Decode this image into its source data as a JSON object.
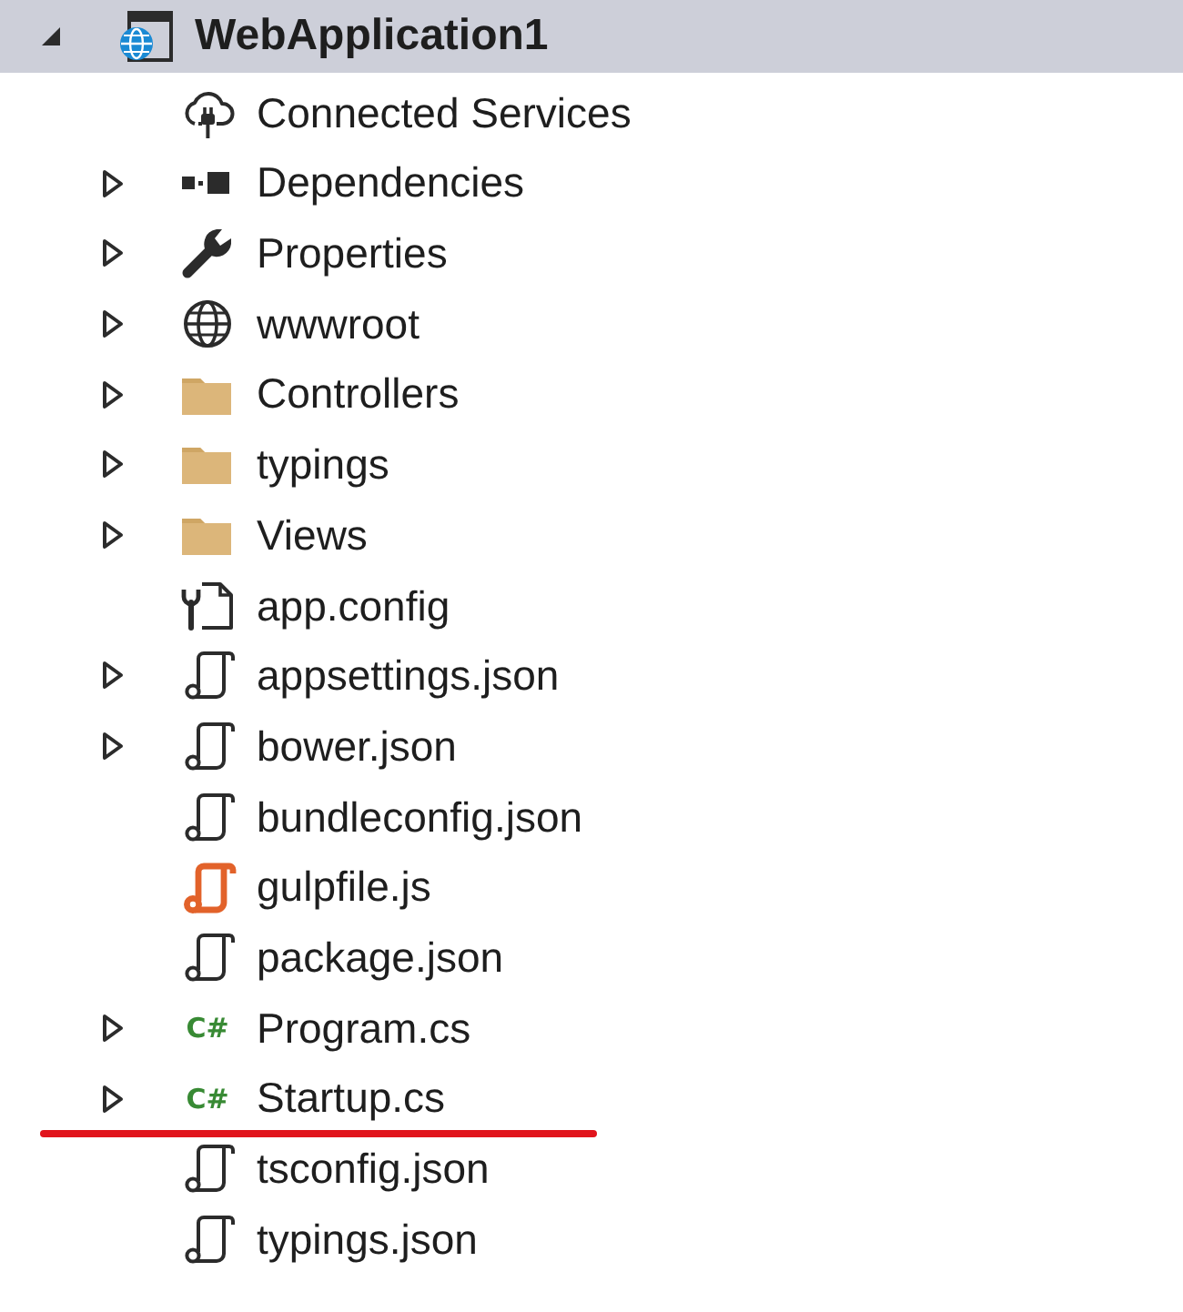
{
  "tree": {
    "root": {
      "label": "WebApplication1",
      "kind": "web-project",
      "expanded": true,
      "selected": true,
      "underlined": false,
      "children": [
        {
          "label": "Connected Services",
          "kind": "connected-services",
          "selected": false,
          "underlined": false
        },
        {
          "label": "Dependencies",
          "kind": "dependencies",
          "expanded": false,
          "selected": false,
          "underlined": false
        },
        {
          "label": "Properties",
          "kind": "properties",
          "expanded": false,
          "selected": false,
          "underlined": false
        },
        {
          "label": "wwwroot",
          "kind": "web-root",
          "expanded": false,
          "selected": false,
          "underlined": false
        },
        {
          "label": "Controllers",
          "kind": "folder",
          "expanded": false,
          "selected": false,
          "underlined": false
        },
        {
          "label": "typings",
          "kind": "folder",
          "expanded": false,
          "selected": false,
          "underlined": false
        },
        {
          "label": "Views",
          "kind": "folder",
          "expanded": false,
          "selected": false,
          "underlined": false
        },
        {
          "label": "app.config",
          "kind": "config",
          "selected": false,
          "underlined": false
        },
        {
          "label": "appsettings.json",
          "kind": "json",
          "expanded": false,
          "selected": false,
          "underlined": false
        },
        {
          "label": "bower.json",
          "kind": "json",
          "expanded": false,
          "selected": false,
          "underlined": false
        },
        {
          "label": "bundleconfig.json",
          "kind": "json",
          "selected": false,
          "underlined": false
        },
        {
          "label": "gulpfile.js",
          "kind": "script",
          "selected": false,
          "underlined": false
        },
        {
          "label": "package.json",
          "kind": "json",
          "selected": false,
          "underlined": false
        },
        {
          "label": "Program.cs",
          "kind": "csharp",
          "icon_text": "C#",
          "expanded": false,
          "selected": false,
          "underlined": false
        },
        {
          "label": "Startup.cs",
          "kind": "csharp",
          "icon_text": "C#",
          "expanded": false,
          "selected": false,
          "underlined": true
        },
        {
          "label": "tsconfig.json",
          "kind": "json",
          "selected": false,
          "underlined": false
        },
        {
          "label": "typings.json",
          "kind": "json",
          "selected": false,
          "underlined": false
        }
      ]
    }
  }
}
